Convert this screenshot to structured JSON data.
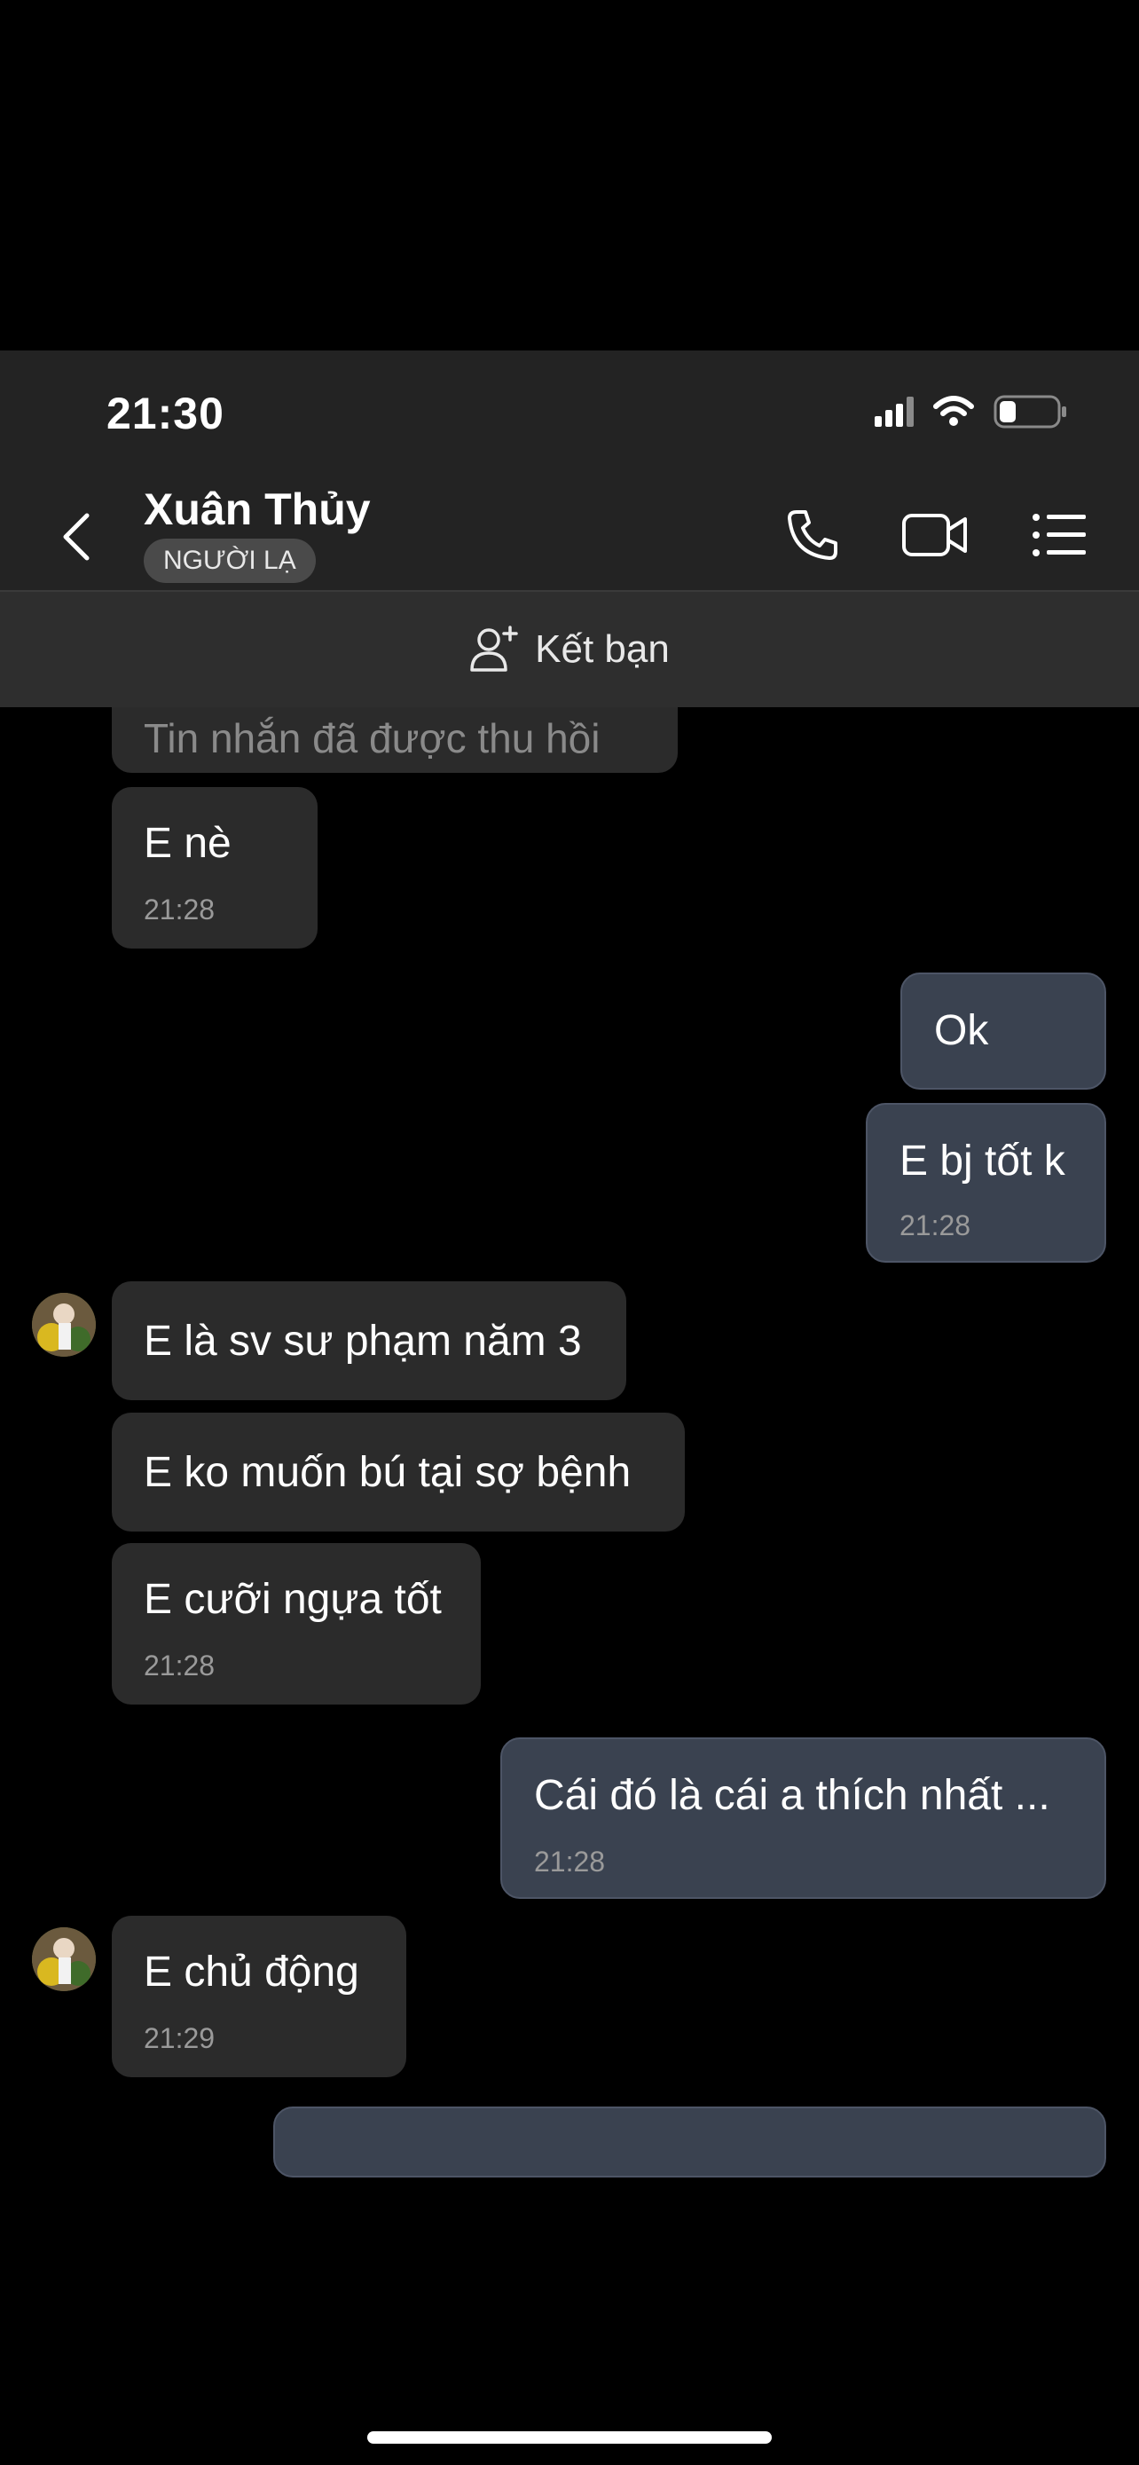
{
  "status_bar": {
    "time": "21:30"
  },
  "header": {
    "contact_name": "Xuân Thủy",
    "badge": "NGƯỜI LẠ"
  },
  "friend_bar": {
    "label": "Kết bạn"
  },
  "messages": [
    {
      "side": "in",
      "text": "Tin nhắn đã được thu hồi",
      "time": ""
    },
    {
      "side": "in",
      "text": "E nè",
      "time": "21:28"
    },
    {
      "side": "out",
      "text": "Ok",
      "time": ""
    },
    {
      "side": "out",
      "text": "E bj tốt k",
      "time": "21:28"
    },
    {
      "side": "in",
      "text": "E là sv sư phạm năm 3",
      "time": ""
    },
    {
      "side": "in",
      "text": "E ko muốn bú tại sợ bệnh",
      "time": ""
    },
    {
      "side": "in",
      "text": "E cưỡi ngựa tốt",
      "time": "21:28"
    },
    {
      "side": "out",
      "text": "Cái đó là cái a thích nhất ...",
      "time": "21:28"
    },
    {
      "side": "in",
      "text": "E chủ động",
      "time": "21:29"
    }
  ],
  "colors": {
    "incoming_bubble": "#2b2b2b",
    "outgoing_bubble": "#3a4250",
    "header_bg": "#232323"
  }
}
